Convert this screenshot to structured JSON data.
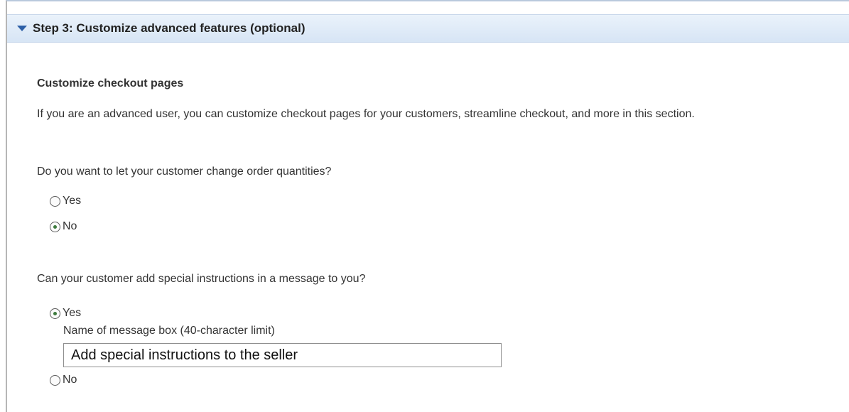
{
  "step": {
    "title": "Step 3: Customize advanced features (optional)"
  },
  "section": {
    "title": "Customize checkout pages",
    "intro": "If you are an advanced user, you can customize checkout pages for your customers, streamline checkout, and more in this section."
  },
  "questions": [
    {
      "text": "Do you want to let your customer change order quantities?",
      "options": [
        {
          "label": "Yes",
          "checked": false
        },
        {
          "label": "No",
          "checked": true
        }
      ]
    },
    {
      "text": "Can your customer add special instructions in a message to you?",
      "options": [
        {
          "label": "Yes",
          "checked": true
        },
        {
          "label": "No",
          "checked": false
        }
      ],
      "message_box": {
        "label": "Name of message box (40-character limit)",
        "value": "Add special instructions to the seller"
      }
    }
  ],
  "colors": {
    "header_background": "#d7e5f5",
    "toggle_icon": "#2d5fa6",
    "radio_selected": "#3d7a3d"
  },
  "icons": {
    "toggle": "triangle-down-icon"
  }
}
